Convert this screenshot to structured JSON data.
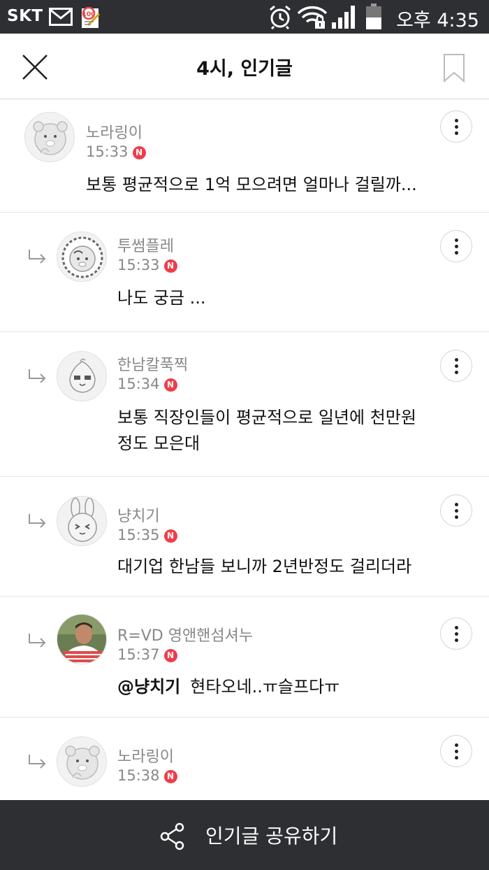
{
  "status_bar": {
    "carrier": "SKT",
    "time": "오후 4:35",
    "icons": [
      "mail-icon",
      "app-notification-icon",
      "alarm-icon",
      "wifi-locked-icon",
      "signal-icon",
      "battery-icon"
    ]
  },
  "header": {
    "title": "4시, 인기글",
    "close_icon": "close-icon",
    "bookmark_icon": "bookmark-icon"
  },
  "comments": [
    {
      "author": "노라링이",
      "time": "15:33",
      "badge": "N",
      "text_lines": [
        "보통 평균적으로 1억 모으려면 얼마나 걸릴까..."
      ],
      "is_reply": false,
      "avatar": "bear-avatar"
    },
    {
      "author": "투썸플레",
      "time": "15:33",
      "badge": "N",
      "text_lines": [
        "나도 궁금 ..."
      ],
      "is_reply": true,
      "avatar": "lion-avatar"
    },
    {
      "author": "한남칼푹찍",
      "time": "15:34",
      "badge": "N",
      "text_lines": [
        "보통 직장인들이 평균적으로 일년에 천만원",
        "정도 모은대"
      ],
      "is_reply": true,
      "avatar": "peach-avatar"
    },
    {
      "author": "냥치기",
      "time": "15:35",
      "badge": "N",
      "text_lines": [
        "대기업 한남들 보니까 2년반정도 걸리더라"
      ],
      "is_reply": true,
      "avatar": "rabbit-avatar"
    },
    {
      "author": "R=VD 영앤핸섬셔누",
      "time": "15:37",
      "badge": "N",
      "mention": "@냥치기",
      "text_lines": [
        "현타오네..ㅠ슬프다ㅠ"
      ],
      "is_reply": true,
      "avatar": "photo-avatar"
    },
    {
      "author": "노라링이",
      "time": "15:38",
      "badge": "N",
      "text_lines": [],
      "is_reply": true,
      "avatar": "bear-avatar"
    }
  ],
  "share_bar": {
    "label": "인기글 공유하기",
    "icon": "share-icon"
  },
  "colors": {
    "status_bar_bg": "#2e2f33",
    "share_bar_bg": "#2e2f33",
    "new_badge": "#f03c4a",
    "meta_text": "#888888"
  }
}
